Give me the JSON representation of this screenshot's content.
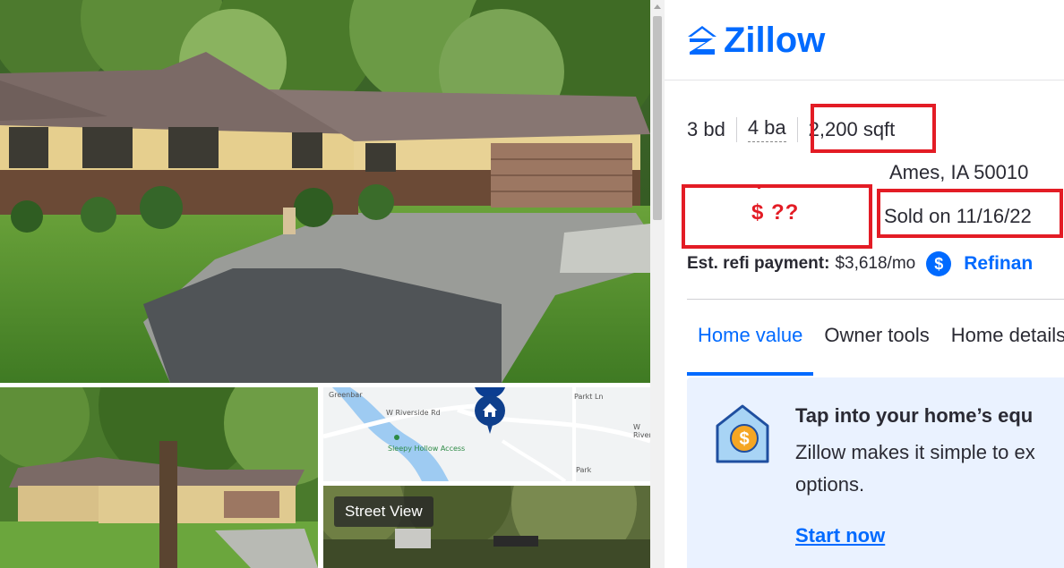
{
  "brand": {
    "name": "Zillow",
    "color": "#006aff"
  },
  "facts": {
    "beds": "3 bd",
    "baths": "4 ba",
    "sqft": "2,200 sqft"
  },
  "address": "Ames, IA 50010",
  "price": "$ ??",
  "sold": "Sold on 11/16/22",
  "refi": {
    "label": "Est. refi payment:",
    "value": "$3,618/mo",
    "icon": "dollar-icon",
    "link": "Refinan"
  },
  "tabs": [
    {
      "label": "Home value",
      "active": true
    },
    {
      "label": "Owner tools",
      "active": false
    },
    {
      "label": "Home details",
      "active": false
    }
  ],
  "card": {
    "icon": "house-dollar-icon",
    "title": "Tap into your home’s equ",
    "body": "Zillow makes it simple to ex options.",
    "link": "Start now"
  },
  "media": {
    "street_view_label": "Street View",
    "map_labels": [
      "W Riverside Rd",
      "Sleepy Hollow Access",
      "W Rivers",
      "Parkt Ln",
      "Greenbar",
      "Park"
    ]
  },
  "colors": {
    "accent": "#006aff",
    "highlight": "#e31c25",
    "card_bg": "#eaf2ff"
  }
}
